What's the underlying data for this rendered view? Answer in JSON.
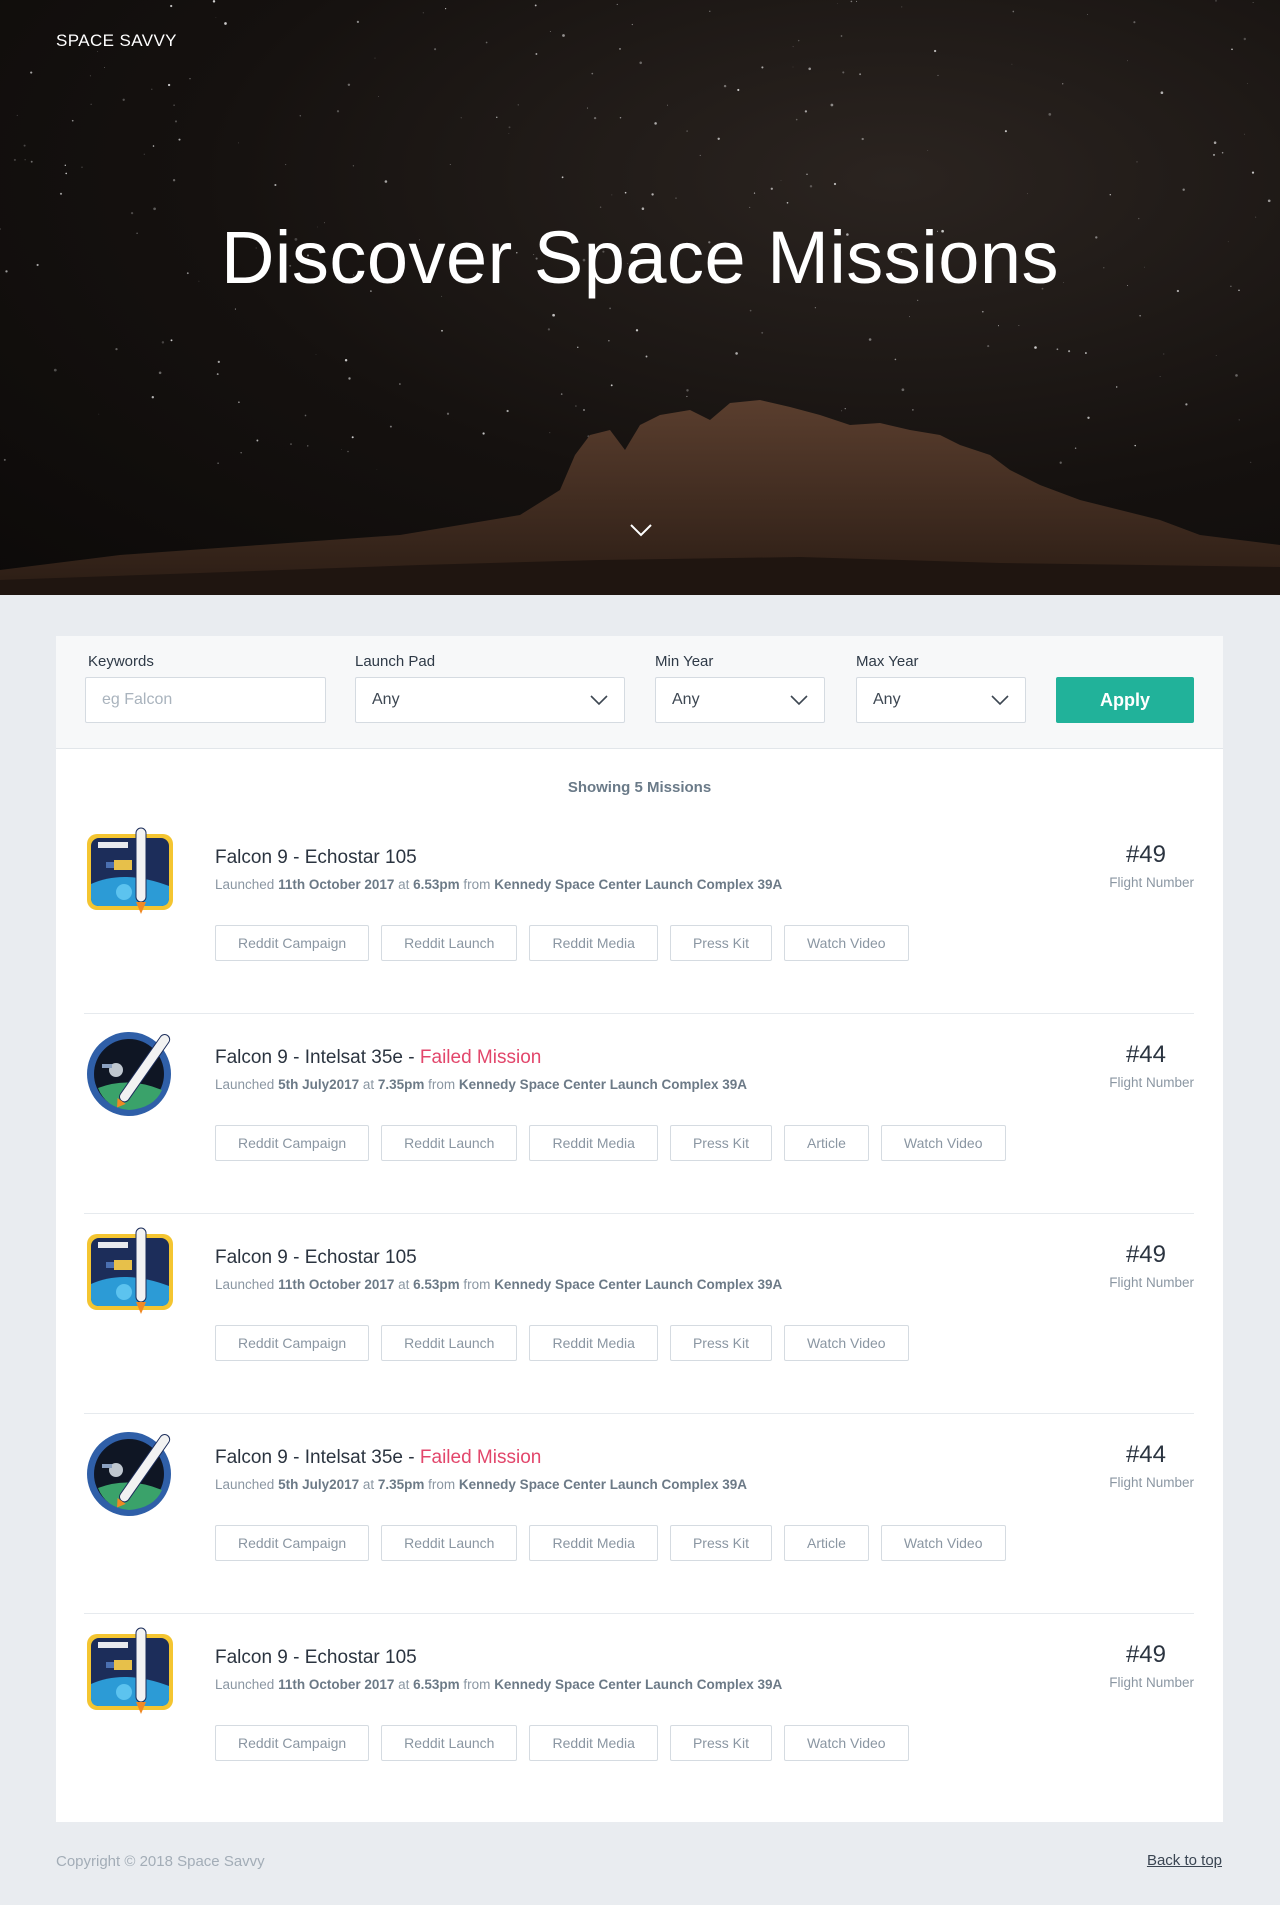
{
  "header": {
    "brand": "SPACE SAVVY",
    "title": "Discover Space Missions"
  },
  "filters": {
    "keywords": {
      "label": "Keywords",
      "placeholder": "eg Falcon",
      "value": ""
    },
    "launch_pad": {
      "label": "Launch Pad",
      "value": "Any"
    },
    "min_year": {
      "label": "Min Year",
      "value": "Any"
    },
    "max_year": {
      "label": "Max Year",
      "value": "Any"
    },
    "apply_label": "Apply"
  },
  "results": {
    "showing_text": "Showing 5 Missions"
  },
  "missions": [
    {
      "patch": "echostar-105-patch",
      "title": "Falcon 9 - Echostar 105",
      "failed": false,
      "failed_label": "",
      "launched_prefix": "Launched ",
      "date": "11th October 2017",
      "at": " at ",
      "time": "6.53pm",
      "from": " from ",
      "site": "Kennedy Space Center Launch Complex 39A",
      "flight_number": "#49",
      "flight_label": "Flight Number",
      "links": [
        "Reddit Campaign",
        "Reddit Launch",
        "Reddit Media",
        "Press Kit",
        "Watch Video"
      ]
    },
    {
      "patch": "intelsat-35e-patch",
      "title": "Falcon 9 - Intelsat 35e - ",
      "failed": true,
      "failed_label": "Failed Mission",
      "launched_prefix": "Launched ",
      "date": "5th July2017",
      "at": " at ",
      "time": "7.35pm",
      "from": " from ",
      "site": "Kennedy Space Center Launch Complex 39A",
      "flight_number": "#44",
      "flight_label": "Flight Number",
      "links": [
        "Reddit Campaign",
        "Reddit Launch",
        "Reddit Media",
        "Press Kit",
        "Article",
        "Watch Video"
      ]
    },
    {
      "patch": "echostar-105-patch",
      "title": "Falcon 9 - Echostar 105",
      "failed": false,
      "failed_label": "",
      "launched_prefix": "Launched ",
      "date": "11th October 2017",
      "at": " at ",
      "time": "6.53pm",
      "from": " from ",
      "site": "Kennedy Space Center Launch Complex 39A",
      "flight_number": "#49",
      "flight_label": "Flight Number",
      "links": [
        "Reddit Campaign",
        "Reddit Launch",
        "Reddit Media",
        "Press Kit",
        "Watch Video"
      ]
    },
    {
      "patch": "intelsat-35e-patch",
      "title": "Falcon 9 - Intelsat 35e - ",
      "failed": true,
      "failed_label": "Failed Mission",
      "launched_prefix": "Launched ",
      "date": "5th July2017",
      "at": " at ",
      "time": "7.35pm",
      "from": " from ",
      "site": "Kennedy Space Center Launch Complex 39A",
      "flight_number": "#44",
      "flight_label": "Flight Number",
      "links": [
        "Reddit Campaign",
        "Reddit Launch",
        "Reddit Media",
        "Press Kit",
        "Article",
        "Watch Video"
      ]
    },
    {
      "patch": "echostar-105-patch",
      "title": "Falcon 9 - Echostar 105",
      "failed": false,
      "failed_label": "",
      "launched_prefix": "Launched ",
      "date": "11th October 2017",
      "at": " at ",
      "time": "6.53pm",
      "from": " from ",
      "site": "Kennedy Space Center Launch Complex 39A",
      "flight_number": "#49",
      "flight_label": "Flight Number",
      "links": [
        "Reddit Campaign",
        "Reddit Launch",
        "Reddit Media",
        "Press Kit",
        "Watch Video"
      ]
    }
  ],
  "footer": {
    "copyright": "Copyright © 2018 Space Savvy",
    "back_to_top": "Back to top"
  },
  "colors": {
    "accent": "#21b29a",
    "failed": "#e2466b",
    "background": "#e9ecf0"
  }
}
